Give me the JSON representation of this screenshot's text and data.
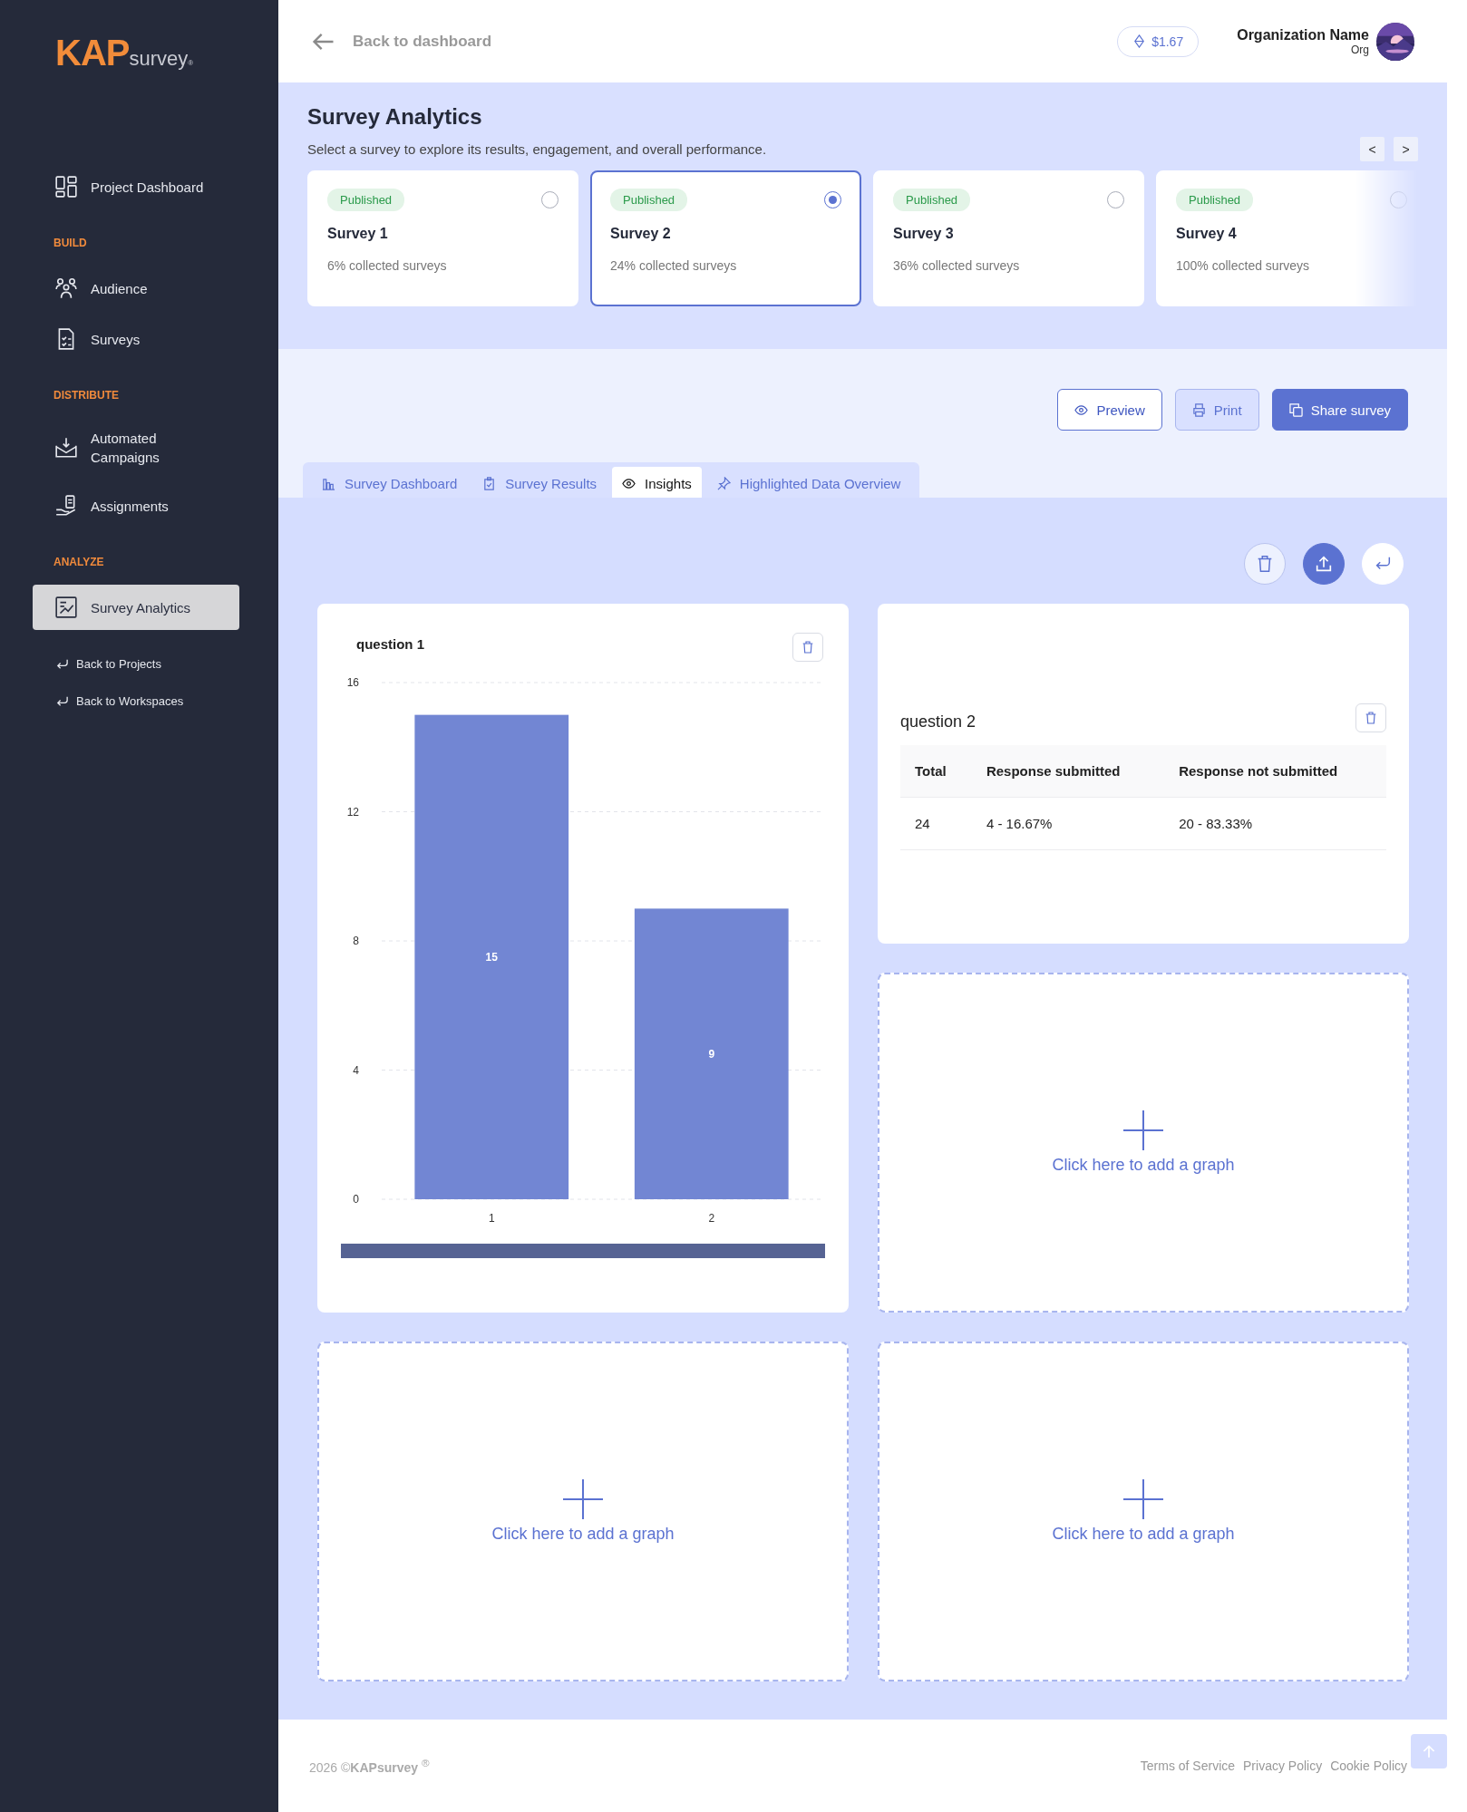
{
  "sidebar": {
    "logo": {
      "brand": "KAP",
      "product": "survey",
      "mark": "®"
    },
    "groups": [
      {
        "items": [
          {
            "label": "Project Dashboard",
            "selected": false
          }
        ]
      },
      {
        "title": "BUILD",
        "items": [
          {
            "label": "Audience",
            "selected": false
          },
          {
            "label": "Surveys",
            "selected": false
          }
        ]
      },
      {
        "title": "DISTRIBUTE",
        "items": [
          {
            "label": "Automated Campaigns",
            "selected": false
          },
          {
            "label": "Assignments",
            "selected": false
          }
        ]
      },
      {
        "title": "ANALYZE",
        "items": [
          {
            "label": "Survey Analytics",
            "selected": true
          }
        ]
      }
    ],
    "back_links": [
      "Back to Projects",
      "Back to Workspaces"
    ]
  },
  "header": {
    "back": "Back to dashboard",
    "credits": "$1.67",
    "org_name": "Organization Name",
    "org_role": "Org"
  },
  "analytics": {
    "title": "Survey Analytics",
    "subtitle": "Select a survey to explore its results, engagement, and overall performance.",
    "prev": "<",
    "next": ">",
    "surveys": [
      {
        "status": "Published",
        "name": "Survey 1",
        "collected": "6% collected surveys",
        "selected": false
      },
      {
        "status": "Published",
        "name": "Survey 2",
        "collected": "24% collected surveys",
        "selected": true
      },
      {
        "status": "Published",
        "name": "Survey 3",
        "collected": "36% collected surveys",
        "selected": false
      },
      {
        "status": "Published",
        "name": "Survey 4",
        "collected": "100% collected surveys",
        "selected": false
      }
    ]
  },
  "actions": [
    {
      "kind": "outline",
      "label": "Preview"
    },
    {
      "kind": "soft",
      "label": "Print"
    },
    {
      "kind": "primary",
      "label": "Share survey"
    }
  ],
  "tabs": [
    {
      "label": "Survey Dashboard",
      "selected": false
    },
    {
      "label": "Survey Results",
      "selected": false
    },
    {
      "label": "Insights",
      "selected": true
    },
    {
      "label": "Highlighted Data Overview",
      "selected": false
    }
  ],
  "widgets": [
    {
      "kind": "chart",
      "title": "question 1",
      "chart_data": {
        "type": "bar",
        "categories": [
          "1",
          "2"
        ],
        "values": [
          15,
          9
        ],
        "ylim": [
          0,
          16
        ],
        "yticks": [
          0,
          4,
          8,
          12,
          16
        ],
        "grid": true,
        "data_labels": true
      }
    },
    {
      "kind": "table",
      "title": "question 2",
      "columns": [
        "Total",
        "Response submitted",
        "Response not submitted"
      ],
      "rows": [
        [
          "24",
          "4 - 16.67%",
          "20 - 83.33%"
        ]
      ]
    },
    {
      "kind": "empty",
      "label": "Click here to add a graph"
    },
    {
      "kind": "empty",
      "label": "Click here to add a graph"
    },
    {
      "kind": "empty",
      "label": "Click here to add a graph"
    }
  ],
  "footer": {
    "copyright": "2026 ©**KAPsurvey** $^{®}$",
    "links": [
      "Terms of Service",
      "Privacy Policy",
      "Cookie Policy"
    ]
  }
}
